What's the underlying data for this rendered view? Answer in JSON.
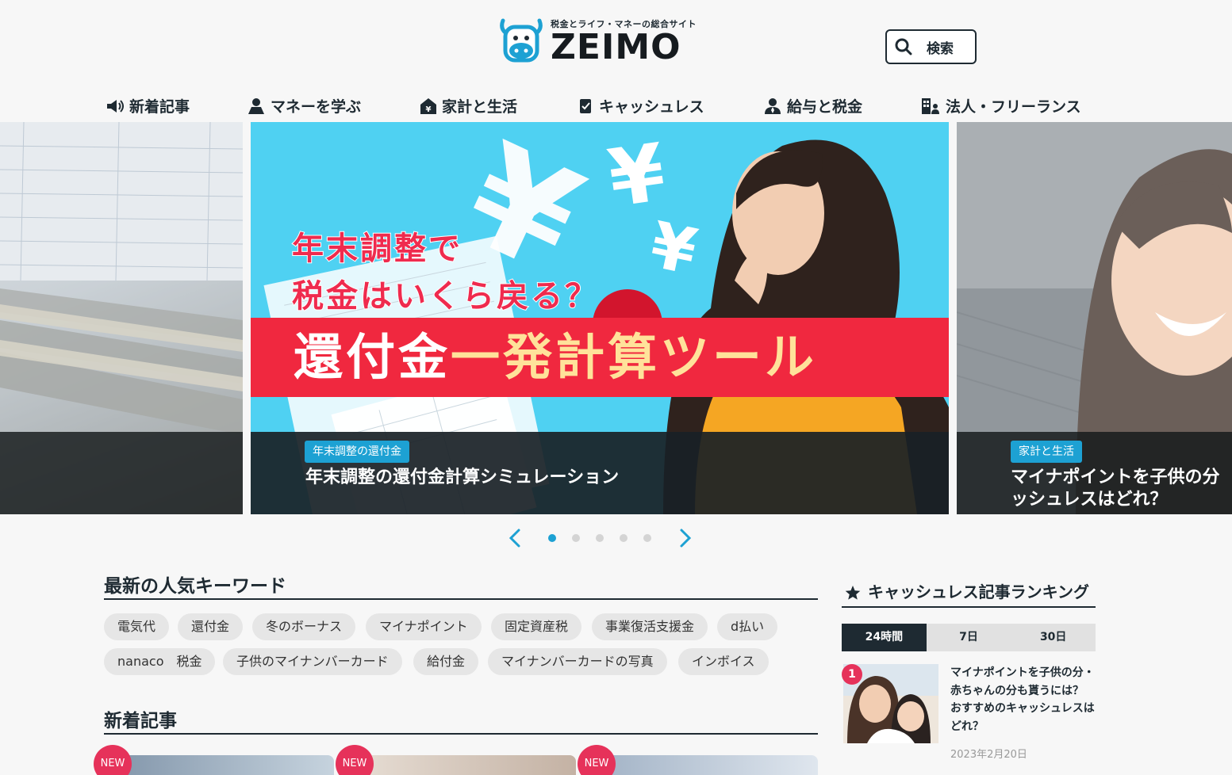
{
  "header": {
    "tagline": "税金とライフ・マネーの総合サイト",
    "logo_text": "ZEIMO",
    "search_label": "検索"
  },
  "nav": {
    "items": [
      {
        "label": "新着記事",
        "icon": "megaphone-icon"
      },
      {
        "label": "マネーを学ぶ",
        "icon": "learner-icon"
      },
      {
        "label": "家計と生活",
        "icon": "house-yen-icon"
      },
      {
        "label": "キャッシュレス",
        "icon": "card-check-icon"
      },
      {
        "label": "給与と税金",
        "icon": "salaryman-icon"
      },
      {
        "label": "法人・フリーランス",
        "icon": "building-person-icon"
      }
    ]
  },
  "slider": {
    "left": {
      "badge": "",
      "title": ""
    },
    "main": {
      "headline_line1": "年末調整で",
      "headline_line2": "税金はいくら戻る？",
      "banner_white": "還付金",
      "banner_yellow": "一発計算ツール",
      "badge": "年末調整の還付金",
      "title": "年末調整の還付金計算シミュレーション"
    },
    "right": {
      "badge": "家計と生活",
      "title_line1": "マイナポイントを子供の分",
      "title_line2": "ッシュレスはどれ？"
    },
    "dots_total": 5,
    "active_dot": 1
  },
  "keywords": {
    "title": "最新の人気キーワード",
    "items": [
      "電気代",
      "還付金",
      "冬のボーナス",
      "マイナポイント",
      "固定資産税",
      "事業復活支援金",
      "d払い",
      "nanaco　税金",
      "子供のマイナンバーカード",
      "給付金",
      "マイナンバーカードの写真",
      "インボイス"
    ]
  },
  "new_articles": {
    "title": "新着記事",
    "badge": "NEW"
  },
  "ranking": {
    "title": "キャッシュレス記事ランキング",
    "tabs": [
      "24時間",
      "7日",
      "30日"
    ],
    "active_tab": 0,
    "items": [
      {
        "rank": "1",
        "title": "マイナポイントを子供の分・赤ちゃんの分も貰うには？　おすすめのキャッシュレスはどれ？",
        "date": "2023年2月20日"
      }
    ]
  },
  "colors": {
    "accent": "#1da1d3",
    "dark": "#1e2a32",
    "new_badge": "#e6325a"
  }
}
